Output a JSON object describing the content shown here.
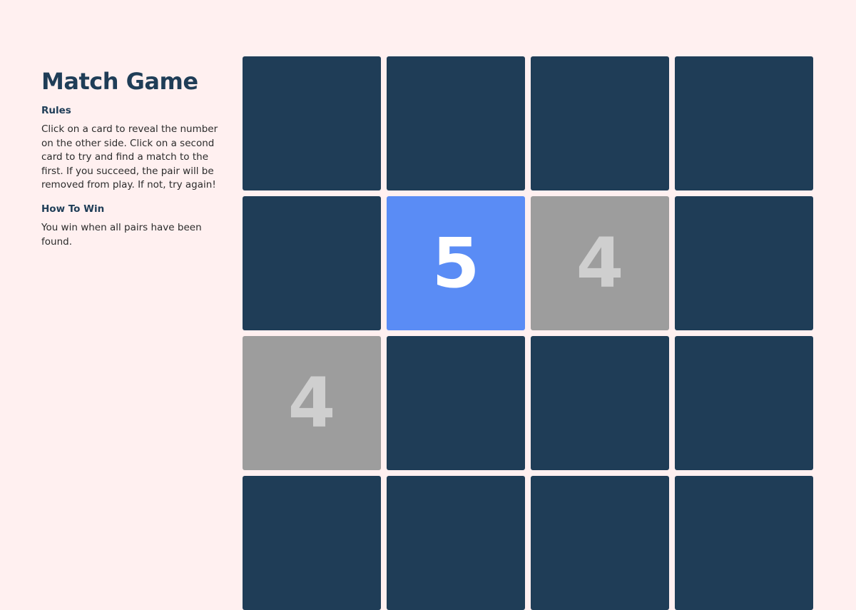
{
  "sidebar": {
    "title": "Match Game",
    "rules_heading": "Rules",
    "rules_text": "Click on a card to reveal the number on the other side. Click on a second card to try and find a match to the first. If you succeed, the pair will be removed from play. If not, try again!",
    "win_heading": "How To Win",
    "win_text": "You win when all pairs have been found."
  },
  "colors": {
    "background": "#fff0f0",
    "card_back": "#1f3d57",
    "card_flipped": "#5a8cf5",
    "card_matched": "#9d9d9d"
  },
  "board": {
    "cards": [
      {
        "state": "hidden",
        "number": ""
      },
      {
        "state": "hidden",
        "number": ""
      },
      {
        "state": "hidden",
        "number": ""
      },
      {
        "state": "hidden",
        "number": ""
      },
      {
        "state": "hidden",
        "number": ""
      },
      {
        "state": "flipped",
        "number": "5"
      },
      {
        "state": "matched",
        "number": "4"
      },
      {
        "state": "hidden",
        "number": ""
      },
      {
        "state": "matched",
        "number": "4"
      },
      {
        "state": "hidden",
        "number": ""
      },
      {
        "state": "hidden",
        "number": ""
      },
      {
        "state": "hidden",
        "number": ""
      },
      {
        "state": "hidden",
        "number": ""
      },
      {
        "state": "hidden",
        "number": ""
      },
      {
        "state": "hidden",
        "number": ""
      },
      {
        "state": "hidden",
        "number": ""
      }
    ]
  }
}
